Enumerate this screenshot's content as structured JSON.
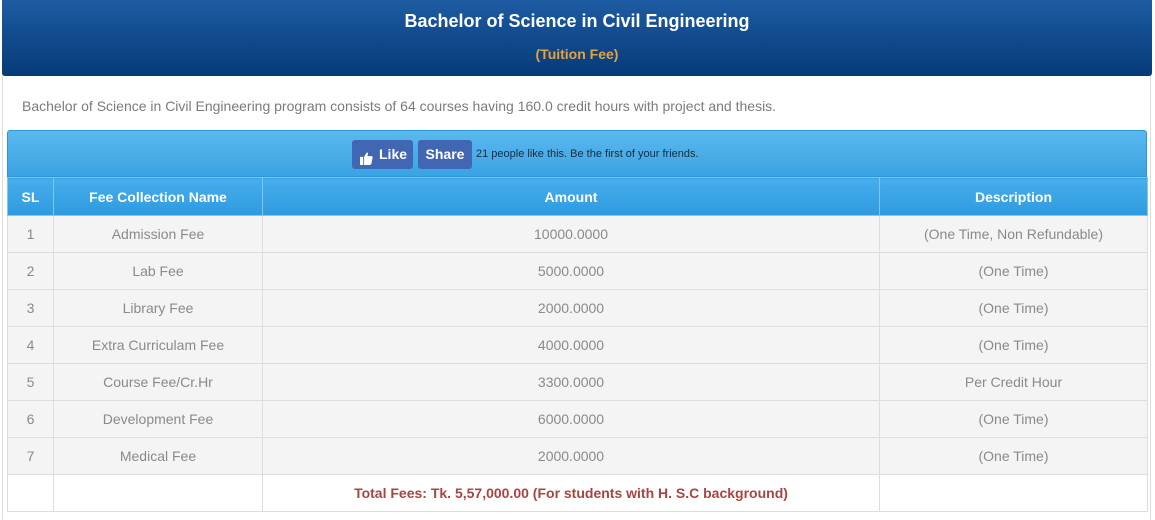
{
  "header": {
    "title": "Bachelor of Science in Civil Engineering",
    "subtitle": "(Tuition Fee)"
  },
  "intro": "Bachelor of Science in Civil Engineering program consists of 64 courses having 160.0 credit hours with project and thesis.",
  "social": {
    "like_label": "Like",
    "share_label": "Share",
    "like_text": "21 people like this. Be the first of your friends.",
    "brand_color": "#4267b2",
    "like_icon": "thumbs-up-icon"
  },
  "table": {
    "headers": [
      "SL",
      "Fee Collection Name",
      "Amount",
      "Description"
    ],
    "rows": [
      {
        "sl": "1",
        "name": "Admission Fee",
        "amount": "10000.0000",
        "description": "(One Time, Non Refundable)"
      },
      {
        "sl": "2",
        "name": "Lab Fee",
        "amount": "5000.0000",
        "description": "(One Time)"
      },
      {
        "sl": "3",
        "name": "Library Fee",
        "amount": "2000.0000",
        "description": "(One Time)"
      },
      {
        "sl": "4",
        "name": "Extra Curriculam Fee",
        "amount": "4000.0000",
        "description": "(One Time)"
      },
      {
        "sl": "5",
        "name": "Course Fee/Cr.Hr",
        "amount": "3300.0000",
        "description": "Per Credit Hour"
      },
      {
        "sl": "6",
        "name": "Development Fee",
        "amount": "6000.0000",
        "description": "(One Time)"
      },
      {
        "sl": "7",
        "name": "Medical Fee",
        "amount": "2000.0000",
        "description": "(One Time)"
      }
    ],
    "total": "Total Fees: Tk. 5,57,000.00 (For students with H. S.C background)"
  },
  "colors": {
    "header_bg": "#114a8d",
    "subtitle": "#e4a33c",
    "table_header_bg": "#3aa3e3",
    "total_text": "#a94442"
  }
}
